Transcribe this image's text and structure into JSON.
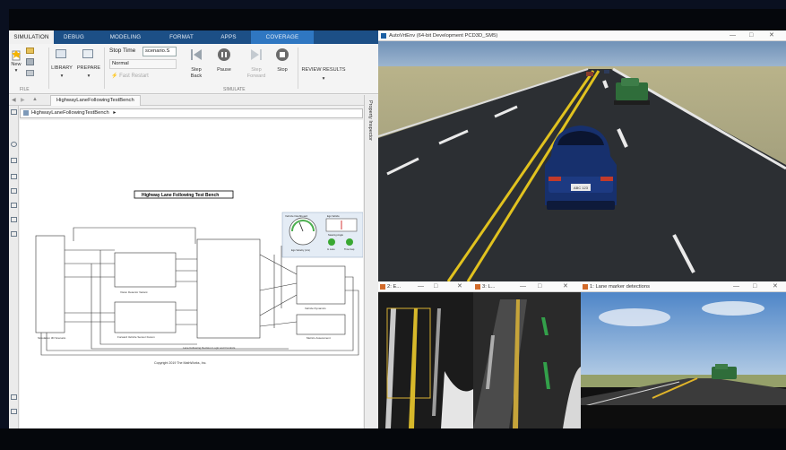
{
  "simulink": {
    "tabs": [
      "SIMULATION",
      "DEBUG",
      "MODELING",
      "FORMAT",
      "APPS",
      "COVERAGE"
    ],
    "ribbon": {
      "new_label": "New",
      "file_section": "FILE",
      "library_label": "LIBRARY",
      "prepare_label": "PREPARE",
      "stop_time_label": "Stop Time",
      "stop_time_value": "scenario.S",
      "mode_value": "Normal",
      "fast_restart_label": "Fast Restart",
      "step_back_label": "Step\nBack",
      "pause_label": "Pause",
      "step_forward_label": "Step\nForward",
      "stop_label": "Stop",
      "simulate_section": "SIMULATE",
      "review_results_label": "REVIEW RESULTS"
    },
    "model_tab": "HighwayLaneFollowingTestBench",
    "breadcrumb": "HighwayLaneFollowingTestBench",
    "property_inspector": "Property Inspector",
    "diagram": {
      "title": "Highway Lane Following Test Bench",
      "copyright": "Copyright 2019 The MathWorks, Inc.",
      "blocks": {
        "scenario": "Simulation 3D Scenario",
        "vision": "Vision Detector Variant",
        "forward": "Forward Vehicle Sensor Fusion",
        "controller": "Lane Following Decision Logic and Controls",
        "vehicle": "Vehicle Dynamics",
        "metrics": "Metrics Assessment",
        "dashboard": "Vehicle Dashboard"
      },
      "dashboard_labels": [
        "Ego Velocity (m/s)",
        "Ego Vehicle",
        "Steering Angle",
        "In Lane",
        "Time Gap"
      ]
    }
  },
  "sim3d": {
    "title": "AutoVrtEnv (64-bit Development PCD3D_SM5)",
    "controls": [
      "—",
      "□",
      "✕"
    ],
    "plate": "ABC 123"
  },
  "panels": [
    {
      "title": "2: E...",
      "controls": [
        "—",
        "□",
        "✕"
      ]
    },
    {
      "title": "3: L...",
      "controls": [
        "—",
        "□",
        "✕"
      ]
    },
    {
      "title": "1: Lane marker detections",
      "controls": [
        "—",
        "□",
        "✕"
      ]
    }
  ]
}
